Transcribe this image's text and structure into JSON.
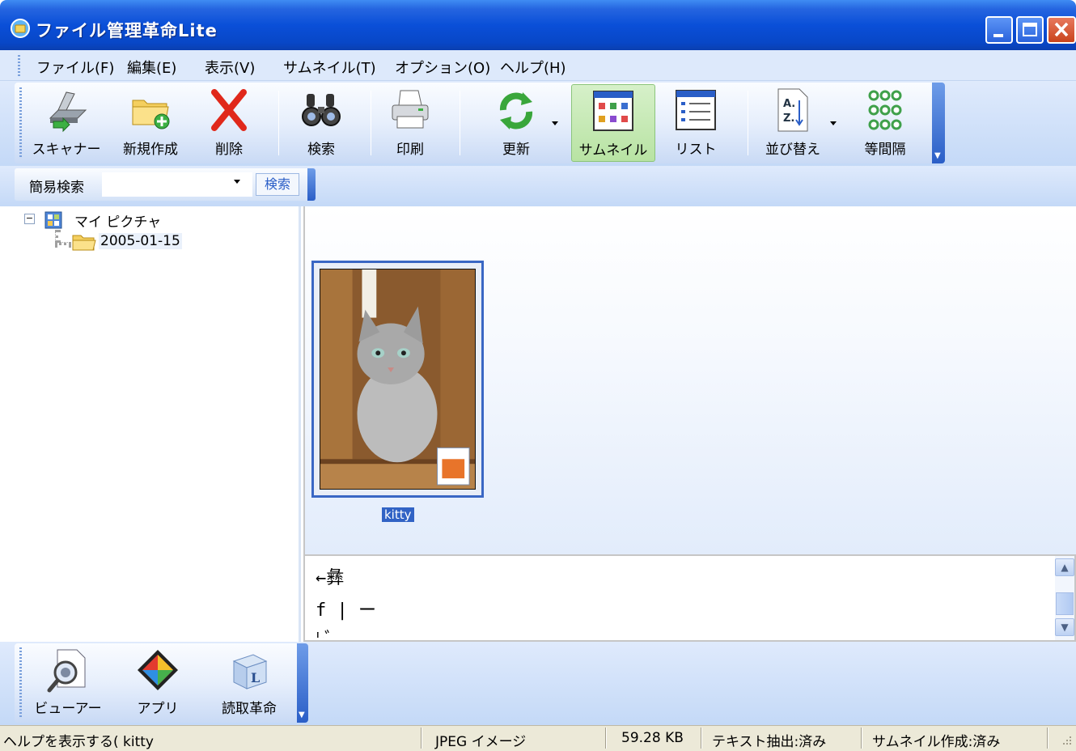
{
  "window": {
    "title": "ファイル管理革命Lite"
  },
  "menu": {
    "items": [
      "ファイル(F)",
      "編集(E)",
      "表示(V)",
      "サムネイル(T)",
      "オプション(O)",
      "ヘルプ(H)"
    ]
  },
  "toolbar": {
    "scanner": "スキャナー",
    "new": "新規作成",
    "delete": "削除",
    "search": "検索",
    "print": "印刷",
    "refresh": "更新",
    "thumbnail": "サムネイル",
    "list": "リスト",
    "sort": "並び替え",
    "spacing": "等間隔"
  },
  "quick_search": {
    "label": "簡易検索",
    "value": "",
    "button": "検索"
  },
  "tree": {
    "root": "マイ ピクチャ",
    "child": "2005-01-15"
  },
  "thumbnails": [
    {
      "caption": "kitty"
    }
  ],
  "text_pane": {
    "lines": [
      "←彝",
      "f | ー",
      "  ﾚﾞ"
    ]
  },
  "app_bar": {
    "viewer": "ビューアー",
    "app": "アプリ",
    "reader": "読取革命"
  },
  "status": {
    "hint": "ヘルプを表示する( kitty",
    "type": "JPEG イメージ",
    "size": "59.28 KB",
    "text_extract": "テキスト抽出:済み",
    "thumb_created": "サムネイル作成:済み"
  },
  "colors": {
    "title_bar": "#0a4fd8",
    "selection": "#3163c5",
    "toolbar_active": "#b8e3a3"
  }
}
